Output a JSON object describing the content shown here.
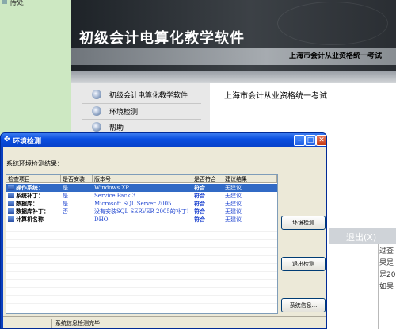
{
  "background": {
    "green_label": "待处",
    "app": {
      "title": "初级会计电算化教学软件",
      "subtitle": "上海市会计从业资格统一考试",
      "menu": [
        "初级会计电算化教学软件",
        "环境检测",
        "帮助"
      ],
      "main_text": "上海市会计从业资格统一考试",
      "exit_label": "退出(X)",
      "side_text": [
        "过查",
        "果是",
        "是20",
        "如果"
      ]
    }
  },
  "dialog": {
    "title": "环境检测",
    "result_label": "系统环境检测结果：",
    "columns": [
      "检查项目",
      "是否安装",
      "版本号",
      "是否符合",
      "建议结果"
    ],
    "rows": [
      {
        "item": "操作系统：",
        "installed": "是",
        "version": "Windows XP",
        "conform": "符合",
        "advice": "无建议"
      },
      {
        "item": "系统补丁：",
        "installed": "是",
        "version": "Service Pack 3",
        "conform": "符合",
        "advice": "无建议"
      },
      {
        "item": "数据库：",
        "installed": "是",
        "version": "Microsoft SQL Server 2005",
        "conform": "符合",
        "advice": "无建议"
      },
      {
        "item": "数据库补丁：",
        "installed": "否",
        "version": "没有安装SQL SERVER 2005的补丁!",
        "conform": "符合",
        "advice": "无建议"
      },
      {
        "item": "计算机名称",
        "installed": "",
        "version": "DHO",
        "conform": "符合",
        "advice": "无建议"
      }
    ],
    "buttons": {
      "check": "环境检测",
      "exit": "退出检测",
      "sysinfo": "系统信息..."
    },
    "status": "系统信息检测完毕!",
    "colors": {
      "title_bar": "#0a4fe0",
      "selected_row": "#316ac5"
    }
  }
}
